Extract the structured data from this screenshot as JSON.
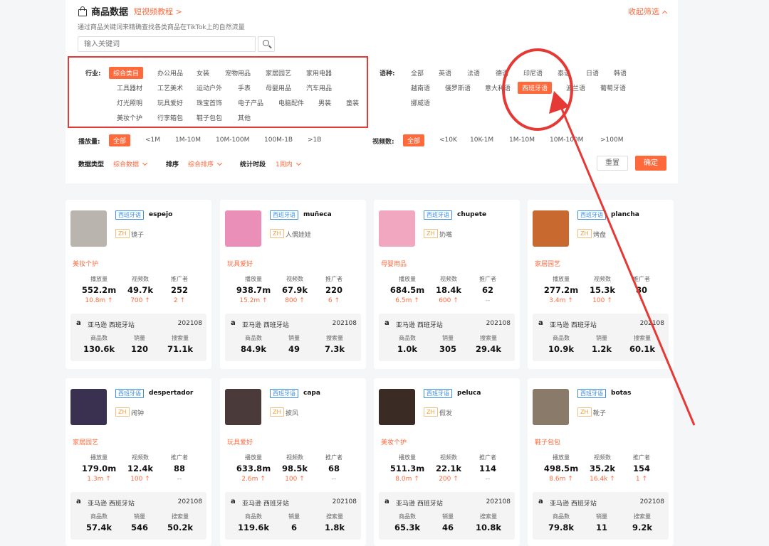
{
  "header": {
    "title": "商品数据",
    "tutorial_link": "短视频教程 >",
    "collapse": "收起筛选",
    "subtitle": "通过商品关键词来精确查找各类商品在TikTok上的自然流量"
  },
  "search": {
    "placeholder": "输入关键词"
  },
  "filters": {
    "industry_label": "行业:",
    "industries": [
      [
        "综合类目",
        "办公用品",
        "女装",
        "宠物用品",
        "家居园艺",
        "家用电器"
      ],
      [
        "工具器材",
        "工艺美术",
        "运动户外",
        "手表",
        "母婴用品",
        "汽车用品"
      ],
      [
        "灯光照明",
        "玩具爱好",
        "珠宝首饰",
        "电子产品",
        "电脑配件",
        "男装",
        "童装"
      ],
      [
        "美妆个护",
        "行李箱包",
        "鞋子包包",
        "其他"
      ]
    ],
    "language_label": "语种:",
    "languages": [
      [
        "全部",
        "英语",
        "法语",
        "德语",
        "印尼语",
        "泰语",
        "日语",
        "韩语"
      ],
      [
        "越南语",
        "俄罗斯语",
        "意大利语",
        "西班牙语",
        "波兰语",
        "葡萄牙语"
      ],
      [
        "挪威语"
      ]
    ],
    "plays_label": "播放量:",
    "plays": [
      "全部",
      "<1M",
      "1M-10M",
      "10M-100M",
      "100M-1B",
      ">1B"
    ],
    "videos_label": "视频数:",
    "videos": [
      "全部",
      "<10K",
      "10K-1M",
      "1M-10M",
      "10M-100M",
      ">100M"
    ],
    "data_type_label": "数据类型",
    "data_type_value": "综合数据",
    "sort_label": "排序",
    "sort_value": "综合排序",
    "period_label": "统计时段",
    "period_value": "1周内",
    "reset": "重置",
    "confirm": "确定"
  },
  "stat_labels": {
    "plays": "播放量",
    "videos": "视频数",
    "promoters": "推广者"
  },
  "amazon_labels": {
    "products": "商品数",
    "sales": "销量",
    "searches": "搜索量"
  },
  "cards": [
    {
      "lang": "西班牙语",
      "keyword": "espejo",
      "zh": "ZH",
      "cn": "镜子",
      "category": "美妆个护",
      "plays": "552.2m",
      "plays_d": "10.8m ↑",
      "videos": "49.7k",
      "videos_d": "700 ↑",
      "promoters": "252",
      "promoters_d": "2 ↑",
      "store": "亚马逊 西班牙站",
      "date": "202108",
      "products": "130.6k",
      "sales": "120",
      "searches": "71.1k",
      "thumb_color": "#b9b4ad"
    },
    {
      "lang": "西班牙语",
      "keyword": "muñeca",
      "zh": "ZH",
      "cn": "人偶娃娃",
      "category": "玩具爱好",
      "plays": "938.7m",
      "plays_d": "15.2m ↑",
      "videos": "67.9k",
      "videos_d": "800 ↑",
      "promoters": "220",
      "promoters_d": "6 ↑",
      "store": "亚马逊 西班牙站",
      "date": "202108",
      "products": "84.9k",
      "sales": "49",
      "searches": "7.3k",
      "thumb_color": "#e98fb8"
    },
    {
      "lang": "西班牙语",
      "keyword": "chupete",
      "zh": "ZH",
      "cn": "奶嘴",
      "category": "母婴用品",
      "plays": "684.5m",
      "plays_d": "6.5m ↑",
      "videos": "18.4k",
      "videos_d": "600 ↑",
      "promoters": "62",
      "promoters_d": "--",
      "store": "亚马逊 西班牙站",
      "date": "202108",
      "products": "1.0k",
      "sales": "305",
      "searches": "29.4k",
      "thumb_color": "#f2a7c0"
    },
    {
      "lang": "西班牙语",
      "keyword": "plancha",
      "zh": "ZH",
      "cn": "烤盘",
      "category": "家居园艺",
      "plays": "277.2m",
      "plays_d": "3.4m ↑",
      "videos": "15.3k",
      "videos_d": "100 ↑",
      "promoters": "80",
      "promoters_d": "--",
      "store": "亚马逊 西班牙站",
      "date": "202108",
      "products": "10.9k",
      "sales": "1.2k",
      "searches": "60.1k",
      "thumb_color": "#c86a30"
    },
    {
      "lang": "西班牙语",
      "keyword": "despertador",
      "zh": "ZH",
      "cn": "闹钟",
      "category": "家居园艺",
      "plays": "179.0m",
      "plays_d": "1.3m ↑",
      "videos": "12.4k",
      "videos_d": "100 ↑",
      "promoters": "88",
      "promoters_d": "--",
      "store": "亚马逊 西班牙站",
      "date": "202108",
      "products": "57.4k",
      "sales": "546",
      "searches": "50.2k",
      "thumb_color": "#3a3150"
    },
    {
      "lang": "西班牙语",
      "keyword": "capa",
      "zh": "ZH",
      "cn": "披风",
      "category": "玩具爱好",
      "plays": "633.8m",
      "plays_d": "2.6m ↑",
      "videos": "98.5k",
      "videos_d": "100 ↑",
      "promoters": "68",
      "promoters_d": "--",
      "store": "亚马逊 西班牙站",
      "date": "202108",
      "products": "119.6k",
      "sales": "6",
      "searches": "1.8k",
      "thumb_color": "#4a3a3a"
    },
    {
      "lang": "西班牙语",
      "keyword": "peluca",
      "zh": "ZH",
      "cn": "假发",
      "category": "美妆个护",
      "plays": "511.3m",
      "plays_d": "8.0m ↑",
      "videos": "22.1k",
      "videos_d": "200 ↑",
      "promoters": "114",
      "promoters_d": "--",
      "store": "亚马逊 西班牙站",
      "date": "202108",
      "products": "65.3k",
      "sales": "46",
      "searches": "10.8k",
      "thumb_color": "#3b2b25"
    },
    {
      "lang": "西班牙语",
      "keyword": "botas",
      "zh": "ZH",
      "cn": "靴子",
      "category": "鞋子包包",
      "plays": "498.5m",
      "plays_d": "8.6m ↑",
      "videos": "35.2k",
      "videos_d": "16.4k ↑",
      "promoters": "154",
      "promoters_d": "1 ↑",
      "store": "亚马逊 西班牙站",
      "date": "202108",
      "products": "79.8k",
      "sales": "11",
      "searches": "9.2k",
      "thumb_color": "#8a7a6a"
    }
  ]
}
